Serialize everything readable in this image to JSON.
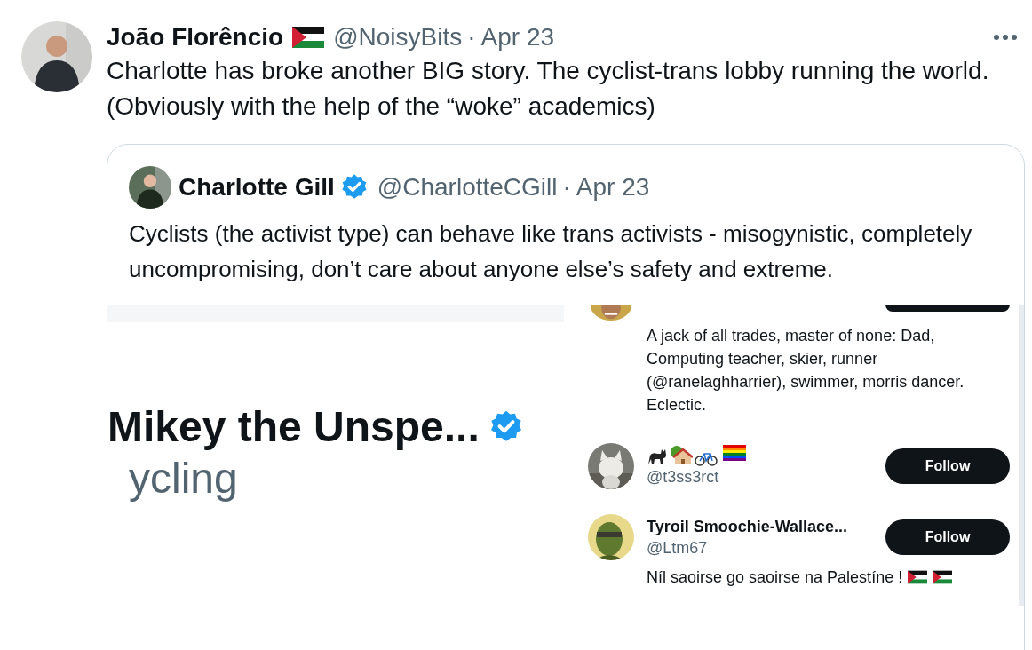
{
  "tweet": {
    "author_name": "João Florêncio",
    "handle": "@NoisyBits",
    "separator": "·",
    "date": "Apr 23",
    "text": "Charlotte has broke another BIG story. The cyclist-trans lobby running the world. (Obviously with the help of the “woke” academics)",
    "quote": {
      "author_name": "Charlotte Gill",
      "verified": true,
      "handle": "@CharlotteCGill",
      "separator": "·",
      "date": "Apr 23",
      "text": "Cyclists (the activist type) can behave like trans activists - misogynistic, completely uncompromising, don’t care about anyone else’s safety and extreme.",
      "image": {
        "left": {
          "name": "Mikey the Unspe...",
          "verified": true,
          "subtitle": "ycling"
        },
        "right": {
          "users": [
            {
              "kind": "bio_only",
              "bio": "A jack of all trades, master of none: Dad, Computing teacher, skier, runner (@ranelaghharrier), swimmer, morris dancer. Eclectic."
            },
            {
              "kind": "emoji_name",
              "handle": "@t3ss3rct",
              "button": "Follow"
            },
            {
              "kind": "named",
              "name": "Tyroil Smoochie-Wallace...",
              "handle": "@Ltm67",
              "button": "Follow",
              "bio": "Níl saoirse go saoirse na Palestíne !"
            }
          ]
        }
      }
    }
  }
}
